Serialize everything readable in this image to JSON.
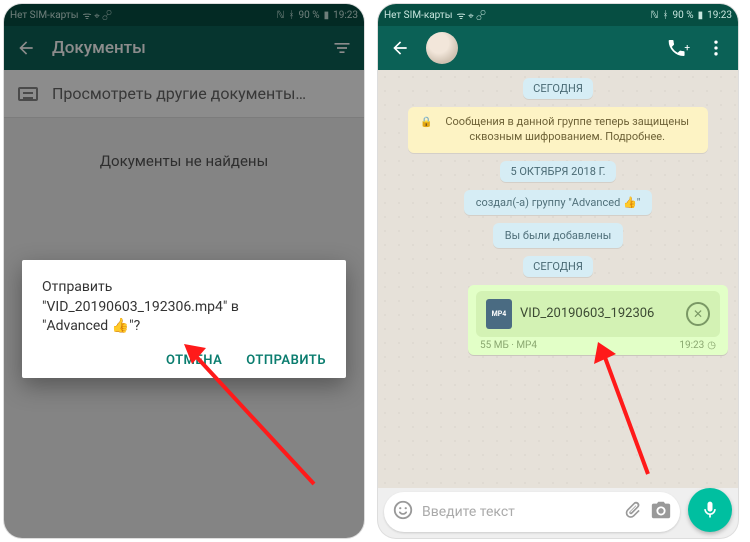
{
  "status": {
    "left_text": "Нет SIM-карты",
    "battery": "90 %",
    "time": "19:23"
  },
  "left": {
    "title": "Документы",
    "browse_label": "Просмотреть другие документы…",
    "empty_label": "Документы не найдены",
    "dialog": {
      "line1": "Отправить",
      "line2": "\"VID_20190603_192306.mp4\" в",
      "line3": "\"Advanced 👍\"?",
      "cancel": "ОТМЕНА",
      "send": "ОТПРАВИТЬ"
    }
  },
  "right": {
    "chips": {
      "today": "СЕГОДНЯ",
      "encryption": "Сообщения в данной группе теперь защищены сквозным шифрованием. Подробнее.",
      "date": "5 ОКТЯБРЯ 2018 Г.",
      "created": "создал(-а) группу \"Advanced 👍\"",
      "added": "Вы были добавлены"
    },
    "doc": {
      "name": "VID_20190603_192306",
      "badge": "MP4",
      "meta_left": "55 МБ · MP4",
      "meta_time": "19:23"
    },
    "input_placeholder": "Введите текст"
  }
}
